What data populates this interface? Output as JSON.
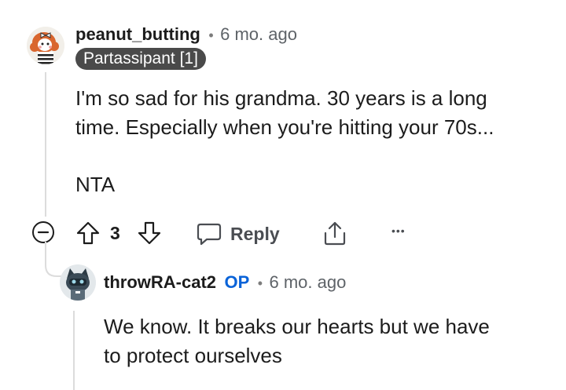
{
  "comment": {
    "author": "peanut_butting",
    "separator": "•",
    "age": "6 mo. ago",
    "flair": "Partassipant [1]",
    "body_line1": "I'm so sad for his grandma. 30 years is a long",
    "body_line2": "time. Especially when you're hitting your 70s...",
    "body_line3": "NTA",
    "vote_count": "3",
    "reply_label": "Reply",
    "more_label": "•••"
  },
  "reply": {
    "author": "throwRA-cat2",
    "op_badge": "OP",
    "separator": "•",
    "age": "6 mo. ago",
    "body_line1": "We know. It breaks our hearts but we have",
    "body_line2": "to protect ourselves"
  },
  "colors": {
    "op_badge": "#0a63d8",
    "flair_bg": "#4a4a4a",
    "thread_line": "#dcdcdc"
  }
}
